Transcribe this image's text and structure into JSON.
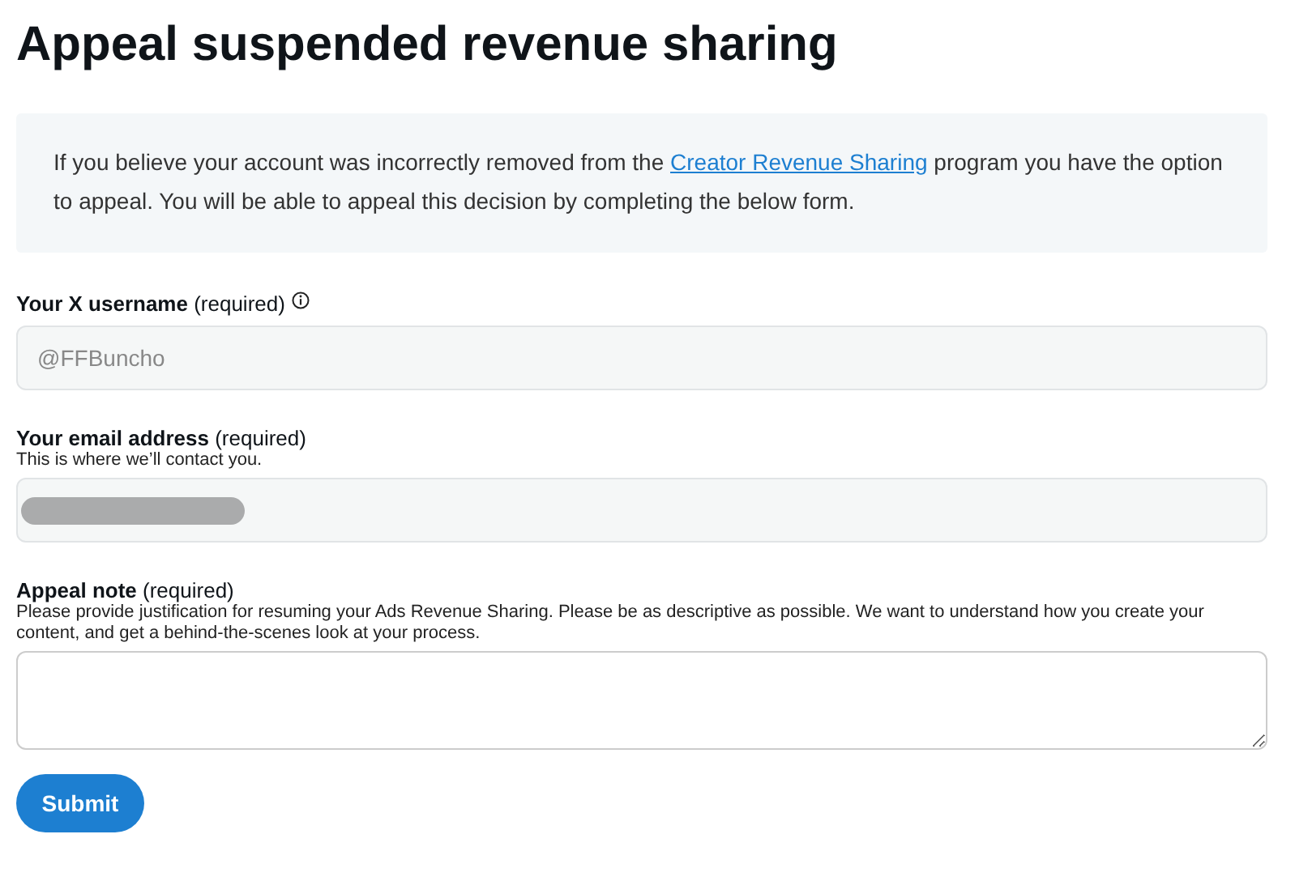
{
  "title": "Appeal suspended revenue sharing",
  "notice": {
    "before": "If you believe your account was incorrectly removed from the ",
    "link": "Creator Revenue Sharing",
    "after": " program you have the option to appeal. You will be able to appeal this decision by completing the below form."
  },
  "fields": [
    {
      "kind": "input",
      "label": "**Your X username** (required)",
      "info_icon": true,
      "value": "@FFBuncho"
    },
    {
      "kind": "input",
      "label": "**Your email address** (required)",
      "hint": "This is where we’ll contact you.",
      "redacted": true
    },
    {
      "kind": "textarea",
      "label": "**Appeal note** (required)",
      "hint": "Please provide justification for resuming your Ads Revenue Sharing. Please be as descriptive as possible. We want to understand how you create your content, and get a behind-the-scenes look at your process."
    }
  ],
  "submit": "Submit"
}
